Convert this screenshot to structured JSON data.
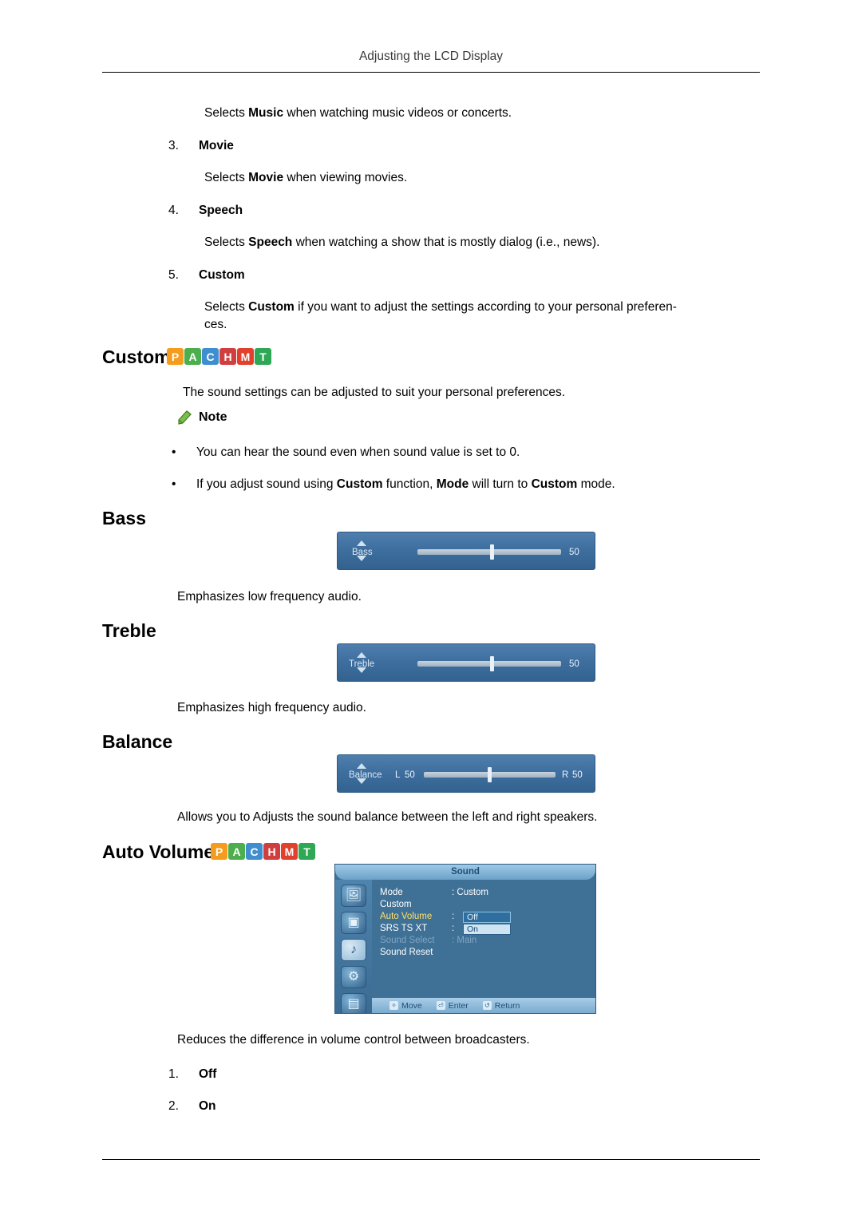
{
  "header": {
    "title": "Adjusting the LCD Display"
  },
  "intro": {
    "music_line": "Selects Music when watching music videos or concerts.",
    "music_pre": "Selects ",
    "music_bold": "Music",
    "music_post": " when watching music videos or concerts."
  },
  "list_items": [
    {
      "num": "3.",
      "label": "Movie",
      "desc_pre": "Selects ",
      "desc_bold": "Movie",
      "desc_post": " when viewing movies."
    },
    {
      "num": "4.",
      "label": "Speech",
      "desc_pre": "Selects ",
      "desc_bold": "Speech",
      "desc_post": " when watching a show that is mostly dialog (i.e., news)."
    },
    {
      "num": "5.",
      "label": "Custom",
      "desc_pre": "Selects ",
      "desc_bold": "Custom",
      "desc_post": " if you want to adjust the settings according to your personal preferen-",
      "desc_post2": "ces."
    }
  ],
  "sections": {
    "custom": {
      "title": "Custom",
      "body": "The sound settings can be adjusted to suit your personal preferences."
    },
    "bass": {
      "title": "Bass",
      "caption": "Emphasizes low frequency audio."
    },
    "treble": {
      "title": "Treble",
      "caption": "Emphasizes high frequency audio."
    },
    "balance": {
      "title": "Balance",
      "caption": "Allows you to Adjusts the sound balance between the left and right speakers."
    },
    "auto_volume": {
      "title": "Auto Volume",
      "caption": "Reduces the difference in volume control between broadcasters."
    }
  },
  "note": {
    "label": "Note",
    "bullets": [
      {
        "text": "You can hear the sound even when sound value is set to 0."
      },
      {
        "pre": "If you adjust sound using ",
        "b1": "Custom",
        "mid1": " function, ",
        "b2": "Mode",
        "mid2": " will turn to ",
        "b3": "Custom",
        "post": " mode."
      }
    ]
  },
  "badges": [
    {
      "letter": "P",
      "color": "#f59b1d"
    },
    {
      "letter": "A",
      "color": "#4cae4c"
    },
    {
      "letter": "C",
      "color": "#3f8fd0"
    },
    {
      "letter": "H",
      "color": "#d03f3f"
    },
    {
      "letter": "M",
      "color": "#e0402d"
    },
    {
      "letter": "T",
      "color": "#2fa855"
    }
  ],
  "osd_sliders": [
    {
      "name": "Bass",
      "label": "Bass",
      "value": "50",
      "knob_pct": 52
    },
    {
      "name": "Treble",
      "label": "Treble",
      "value": "50",
      "knob_pct": 52
    },
    {
      "name": "Balance",
      "label": "Balance",
      "left_label": "L",
      "left_value": "50",
      "right_label": "R",
      "right_value": "50",
      "knob_pct": 50
    }
  ],
  "sound_menu": {
    "title": "Sound",
    "icons": [
      "picture-icon",
      "image-icon",
      "sound-icon",
      "setup-icon",
      "multi-control-icon"
    ],
    "rows": [
      {
        "name": "Mode",
        "value": ": Custom",
        "state": "normal"
      },
      {
        "name": "Custom",
        "value": "",
        "state": "normal"
      },
      {
        "name": "Auto Volume",
        "value": ":",
        "state": "highlight",
        "pill": "Off",
        "pill_style": "off"
      },
      {
        "name": "SRS TS XT",
        "value": ":",
        "state": "normal",
        "pill": "On",
        "pill_style": "on"
      },
      {
        "name": "Sound Select",
        "value": ": Main",
        "state": "dim"
      },
      {
        "name": "Sound Reset",
        "value": "",
        "state": "normal"
      }
    ],
    "footer": [
      {
        "glyph": "✧",
        "label": "Move"
      },
      {
        "glyph": "⏎",
        "label": "Enter"
      },
      {
        "glyph": "↺",
        "label": "Return"
      }
    ]
  },
  "auto_volume_options": [
    {
      "num": "1.",
      "label": "Off"
    },
    {
      "num": "2.",
      "label": "On"
    }
  ]
}
